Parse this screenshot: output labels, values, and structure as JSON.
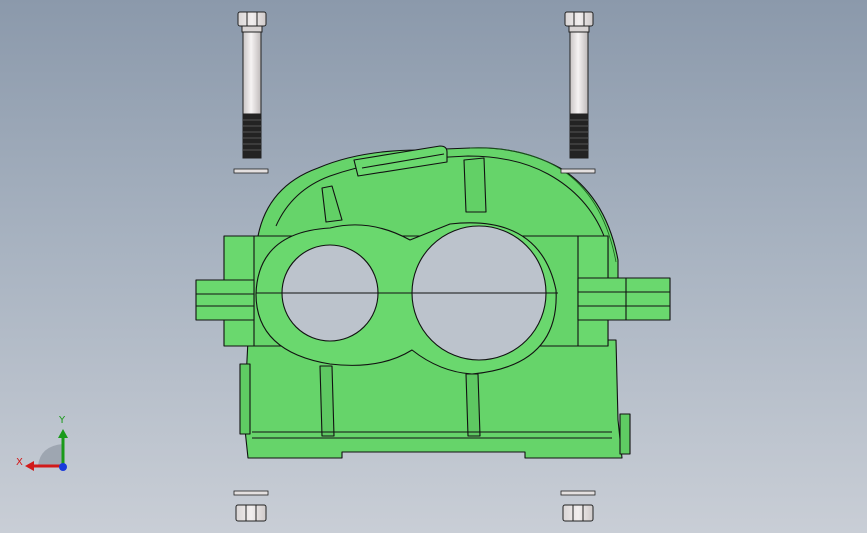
{
  "viewport": {
    "background_top": "#8b99ab",
    "background_bottom": "#c9ced6"
  },
  "model": {
    "body_color": "#66d46a",
    "edge_color": "#111111",
    "bolt_shank_color": "#e8e4e4",
    "bolt_thread_color": "#222222",
    "parts": [
      "gearbox-housing",
      "bolt-left",
      "bolt-right",
      "washer-left-top",
      "washer-right-top",
      "washer-left-bottom",
      "washer-right-bottom",
      "nut-left",
      "nut-right"
    ]
  },
  "triad": {
    "x_label": "X",
    "y_label": "Y",
    "x_color": "#d11a1a",
    "y_color": "#1a9a1a",
    "z_color": "#1a3adb"
  }
}
